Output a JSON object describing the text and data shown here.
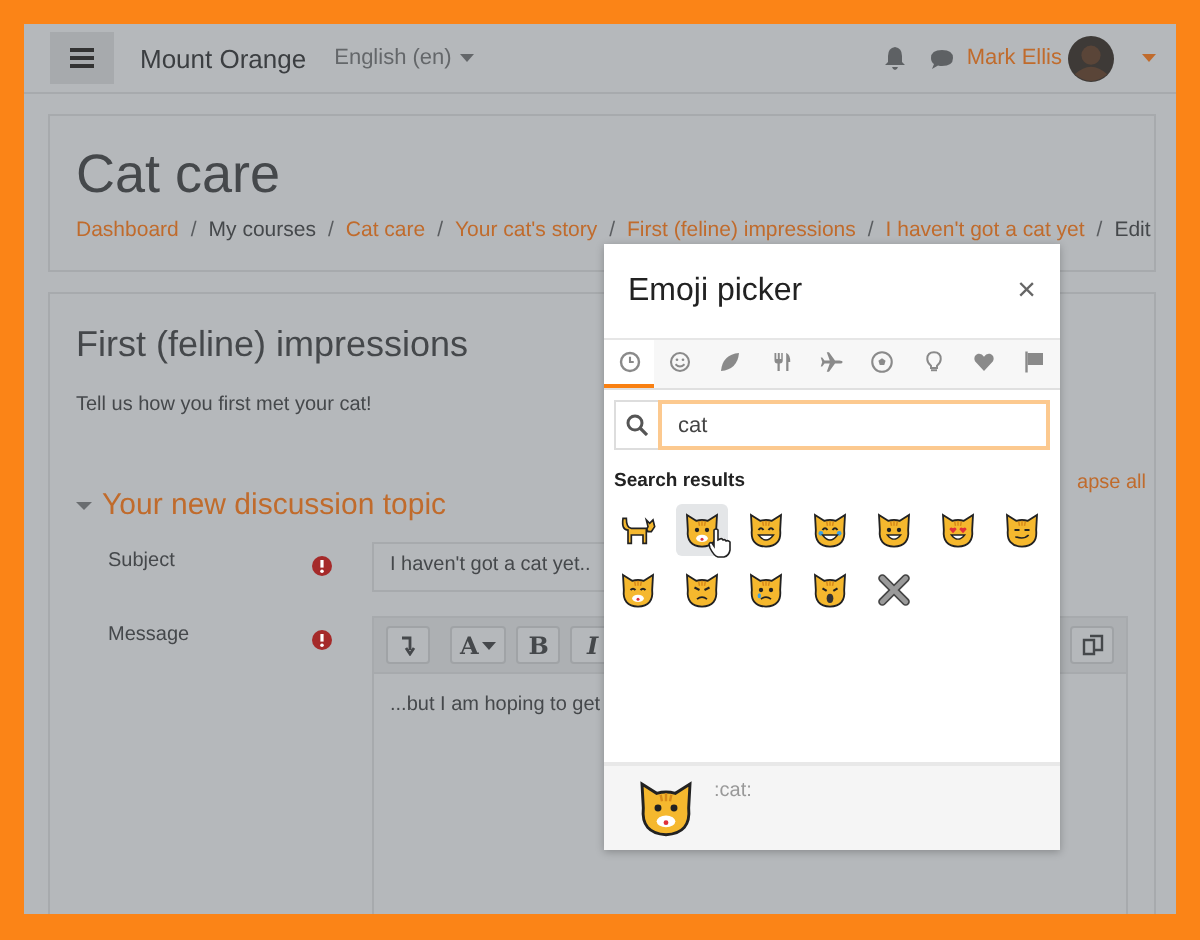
{
  "navbar": {
    "site_name": "Mount Orange",
    "language": "English (en)",
    "user_name": "Mark Ellis"
  },
  "header": {
    "title": "Cat care",
    "separator": "/",
    "breadcrumb": [
      {
        "label": "Dashboard",
        "link": true
      },
      {
        "label": "My courses",
        "link": false
      },
      {
        "label": "Cat care",
        "link": true
      },
      {
        "label": "Your cat's story",
        "link": true
      },
      {
        "label": "First (feline) impressions",
        "link": true
      },
      {
        "label": "I haven't got a cat yet",
        "link": true
      },
      {
        "label": "Edit",
        "link": false
      }
    ]
  },
  "forum": {
    "title": "First (feline) impressions",
    "intro": "Tell us how you first met your cat!",
    "section": {
      "title": "Your new discussion topic",
      "expanded": true
    },
    "collapse_link": "apse all",
    "fields": [
      {
        "label": "Subject",
        "required": true,
        "kind": "input",
        "value": "I  haven't got a cat yet.."
      },
      {
        "label": "Message",
        "required": true,
        "kind": "editor"
      }
    ],
    "editor": {
      "toolbar": [
        {
          "kind": "arrow"
        },
        {
          "kind": "font",
          "label": "A"
        },
        {
          "kind": "bold",
          "label": "B"
        },
        {
          "kind": "italic",
          "label": "I"
        },
        {
          "kind": "copy"
        }
      ],
      "text": "...but I am hoping to get"
    }
  },
  "emoji_picker": {
    "title": "Emoji picker",
    "close": "×",
    "categories": [
      {
        "kind": "clock",
        "selected": true
      },
      {
        "kind": "smiley",
        "selected": false
      },
      {
        "kind": "leaf",
        "selected": false
      },
      {
        "kind": "cutlery",
        "selected": false
      },
      {
        "kind": "plane",
        "selected": false
      },
      {
        "kind": "ball",
        "selected": false
      },
      {
        "kind": "bulb",
        "selected": false
      },
      {
        "kind": "heart",
        "selected": false
      },
      {
        "kind": "flag",
        "selected": false
      }
    ],
    "search": {
      "value": "cat"
    },
    "results_heading": "Search results",
    "results": [
      {
        "kind": "walking-cat",
        "selected": false
      },
      {
        "kind": "cat-face",
        "selected": true
      },
      {
        "kind": "grinning-cat",
        "selected": false
      },
      {
        "kind": "joy-cat",
        "selected": false
      },
      {
        "kind": "smiling-cat",
        "selected": false
      },
      {
        "kind": "heart-eyes-cat",
        "selected": false
      },
      {
        "kind": "smirk-cat",
        "selected": false
      },
      {
        "kind": "kissing-cat",
        "selected": false
      },
      {
        "kind": "pouting-cat",
        "selected": false
      },
      {
        "kind": "crying-cat",
        "selected": false
      },
      {
        "kind": "weary-cat",
        "selected": false
      },
      {
        "kind": "cross",
        "selected": false
      }
    ],
    "preview": {
      "kind": "cat-face",
      "shortcode": ":cat:"
    }
  }
}
